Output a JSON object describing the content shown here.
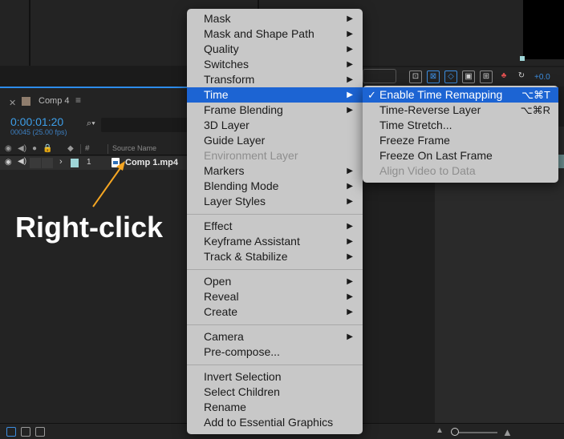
{
  "panel": {
    "tab_title": "Comp 4",
    "timecode": "0:00:01:20",
    "fps_info": "00045 (25.00 fps)",
    "column_source_name": "Source Name",
    "column_number": "#",
    "layer": {
      "number": "1",
      "name": "Comp 1.mp4",
      "label_color": "#9fd6d8"
    }
  },
  "toolbar": {
    "offset_value": "+0.0",
    "accent_color": "#3d8ee0"
  },
  "context_menu": {
    "groups": [
      [
        {
          "label": "Mask",
          "submenu": true
        },
        {
          "label": "Mask and Shape Path",
          "submenu": true
        },
        {
          "label": "Quality",
          "submenu": true
        },
        {
          "label": "Switches",
          "submenu": true
        },
        {
          "label": "Transform",
          "submenu": true
        },
        {
          "label": "Time",
          "submenu": true,
          "highlighted": true
        },
        {
          "label": "Frame Blending",
          "submenu": true
        },
        {
          "label": "3D Layer"
        },
        {
          "label": "Guide Layer"
        },
        {
          "label": "Environment Layer",
          "disabled": true
        },
        {
          "label": "Markers",
          "submenu": true
        },
        {
          "label": "Blending Mode",
          "submenu": true
        },
        {
          "label": "Layer Styles",
          "submenu": true
        }
      ],
      [
        {
          "label": "Effect",
          "submenu": true
        },
        {
          "label": "Keyframe Assistant",
          "submenu": true
        },
        {
          "label": "Track & Stabilize",
          "submenu": true
        }
      ],
      [
        {
          "label": "Open",
          "submenu": true
        },
        {
          "label": "Reveal",
          "submenu": true
        },
        {
          "label": "Create",
          "submenu": true
        }
      ],
      [
        {
          "label": "Camera",
          "submenu": true
        },
        {
          "label": "Pre-compose..."
        }
      ],
      [
        {
          "label": "Invert Selection"
        },
        {
          "label": "Select Children"
        },
        {
          "label": "Rename"
        },
        {
          "label": "Add to Essential Graphics"
        }
      ]
    ],
    "highlight_color": "#1c64d3"
  },
  "time_submenu": {
    "items": [
      {
        "label": "Enable Time Remapping",
        "checked": true,
        "highlighted": true,
        "shortcut": "⌥⌘T"
      },
      {
        "label": "Time-Reverse Layer",
        "shortcut": "⌥⌘R"
      },
      {
        "label": "Time Stretch..."
      },
      {
        "label": "Freeze Frame"
      },
      {
        "label": "Freeze On Last Frame"
      },
      {
        "label": "Align Video to Data",
        "disabled": true
      }
    ]
  },
  "annotation": {
    "text": "Right-click",
    "arrow_color": "#f5a623"
  }
}
